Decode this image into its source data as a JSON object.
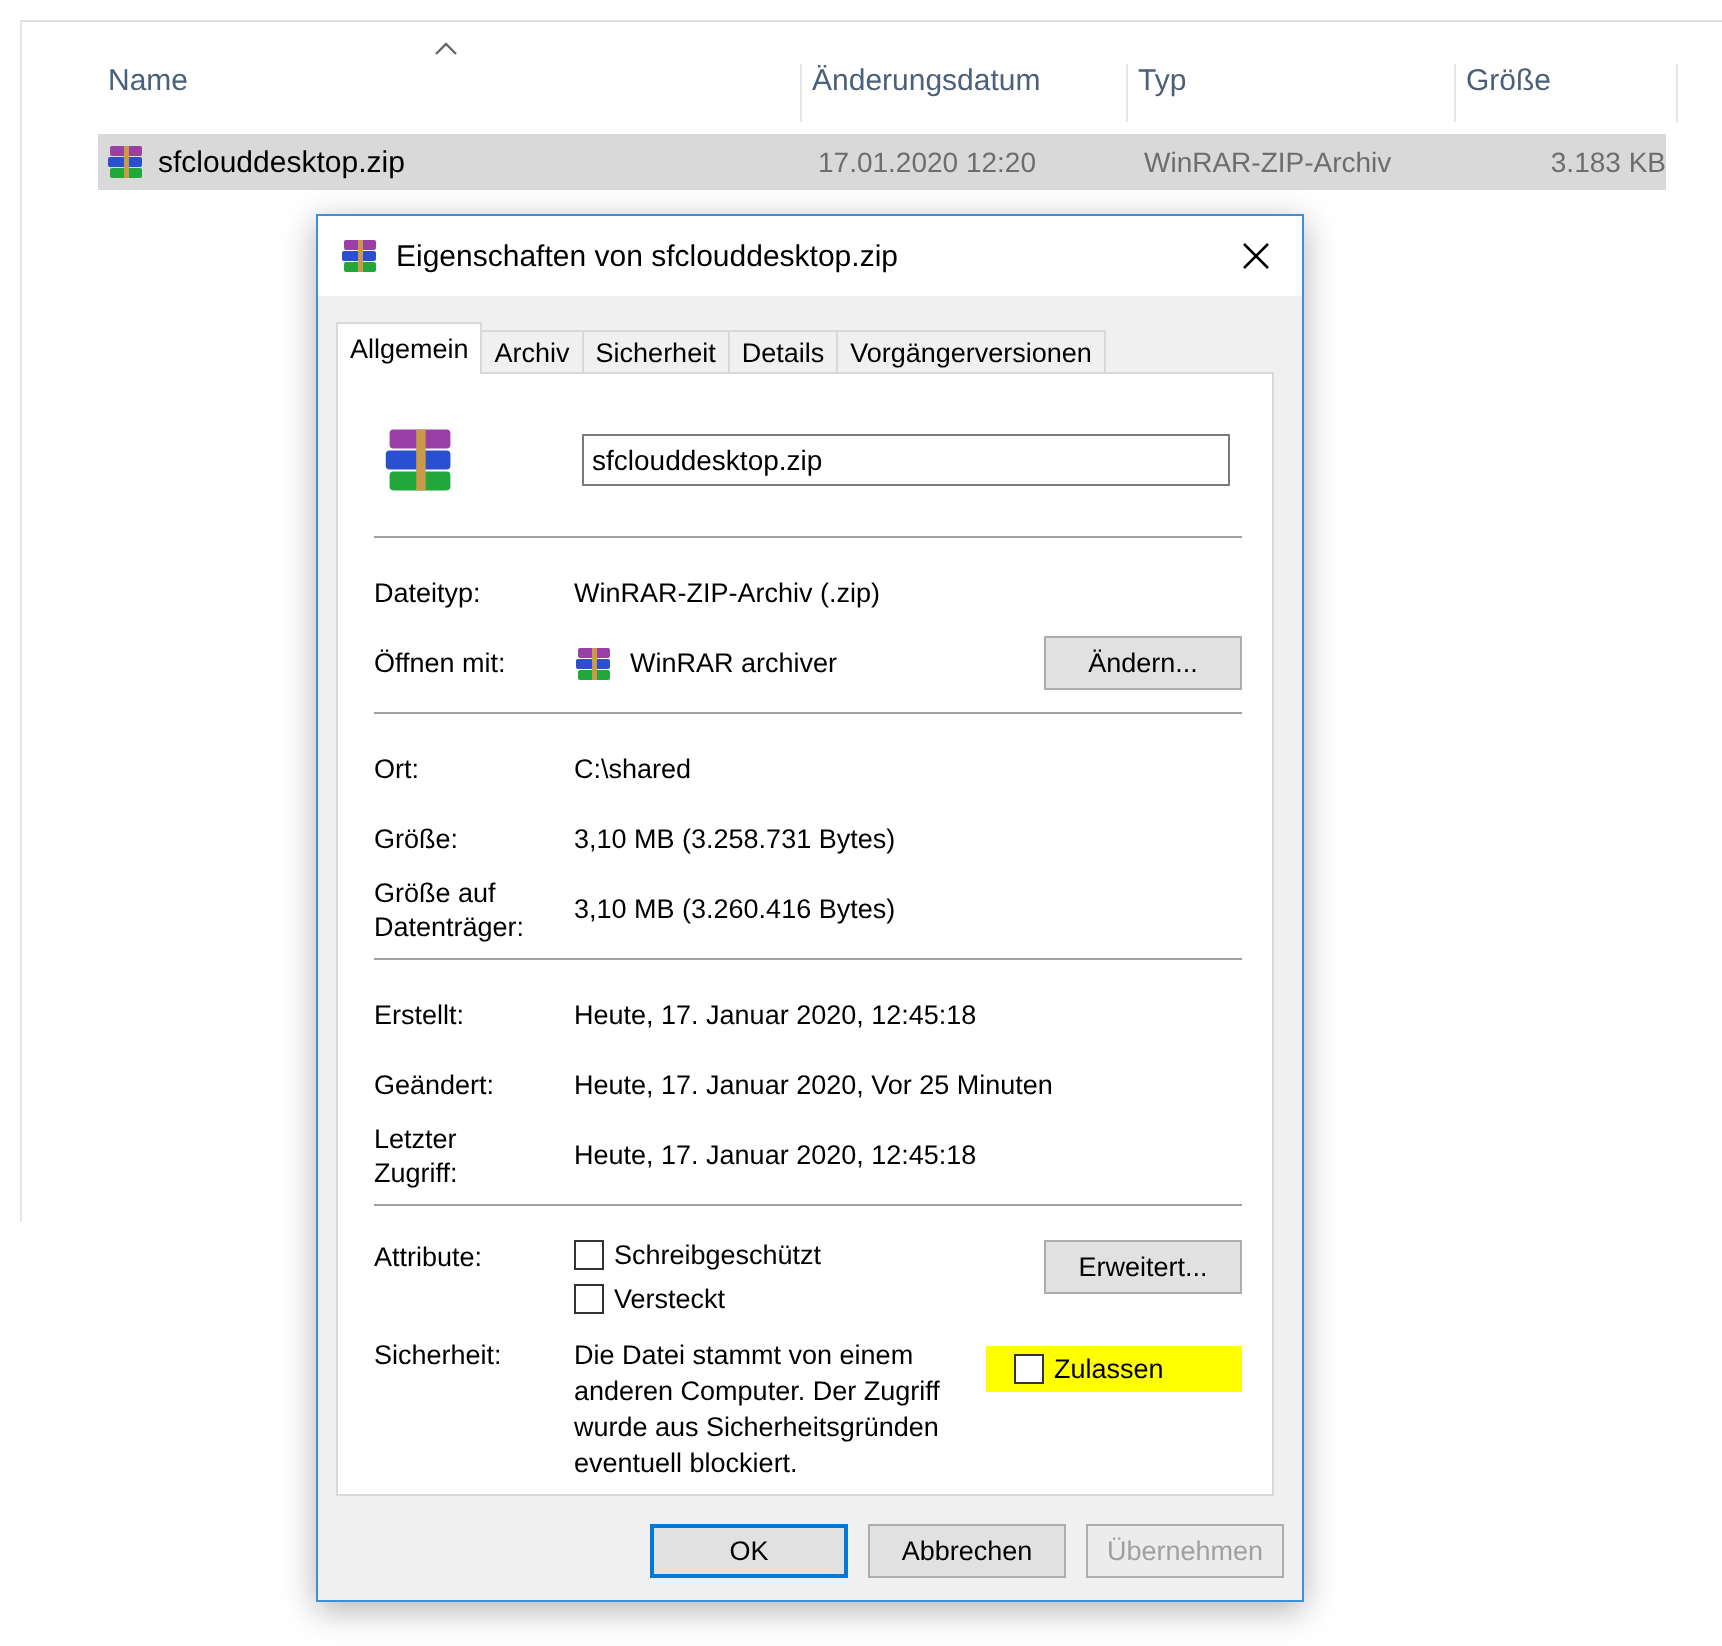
{
  "explorer": {
    "columns": [
      "Name",
      "Änderungsdatum",
      "Typ",
      "Größe"
    ],
    "rows": [
      {
        "name": "sfclouddesktop.zip",
        "date": "17.01.2020 12:20",
        "type": "WinRAR-ZIP-Archiv",
        "size": "3.183 KB",
        "selected": true
      }
    ]
  },
  "dialog": {
    "title": "Eigenschaften von sfclouddesktop.zip",
    "tabs": [
      {
        "label": "Allgemein",
        "selected": true
      },
      {
        "label": "Archiv",
        "selected": false
      },
      {
        "label": "Sicherheit",
        "selected": false
      },
      {
        "label": "Details",
        "selected": false
      },
      {
        "label": "Vorgängerversionen",
        "selected": false
      }
    ],
    "file_name": "sfclouddesktop.zip",
    "sections": [
      [
        {
          "kind": "text",
          "label": "Dateityp:",
          "value": "WinRAR-ZIP-Archiv (.zip)"
        },
        {
          "kind": "app",
          "label": "Öffnen mit:",
          "value": "WinRAR archiver",
          "button": "Ändern..."
        }
      ],
      [
        {
          "kind": "text",
          "label": "Ort:",
          "value": "C:\\shared"
        },
        {
          "kind": "text",
          "label": "Größe:",
          "value": "3,10 MB (3.258.731 Bytes)"
        },
        {
          "kind": "text",
          "label": "Größe auf\nDatenträger:",
          "value": "3,10 MB (3.260.416 Bytes)"
        }
      ],
      [
        {
          "kind": "text",
          "label": "Erstellt:",
          "value": "Heute, 17. Januar 2020, 12:45:18"
        },
        {
          "kind": "text",
          "label": "Geändert:",
          "value": "Heute, 17. Januar 2020, Vor 25 Minuten"
        },
        {
          "kind": "text",
          "label": "Letzter\nZugriff:",
          "value": "Heute, 17. Januar 2020, 12:45:18"
        }
      ]
    ],
    "attributes": {
      "label": "Attribute:",
      "items": [
        {
          "label": "Schreibgeschützt",
          "checked": false
        },
        {
          "label": "Versteckt",
          "checked": false
        }
      ],
      "button": "Erweitert..."
    },
    "security": {
      "label": "Sicherheit:",
      "text": "Die Datei stammt von einem anderen Computer. Der Zugriff wurde aus Sicherheitsgründen eventuell blockiert.",
      "allow": {
        "label": "Zulassen",
        "checked": false,
        "highlighted": true
      }
    },
    "buttons": [
      {
        "label": "OK",
        "default": true,
        "disabled": false
      },
      {
        "label": "Abbrechen",
        "default": false,
        "disabled": false
      },
      {
        "label": "Übernehmen",
        "default": false,
        "disabled": true
      }
    ]
  }
}
